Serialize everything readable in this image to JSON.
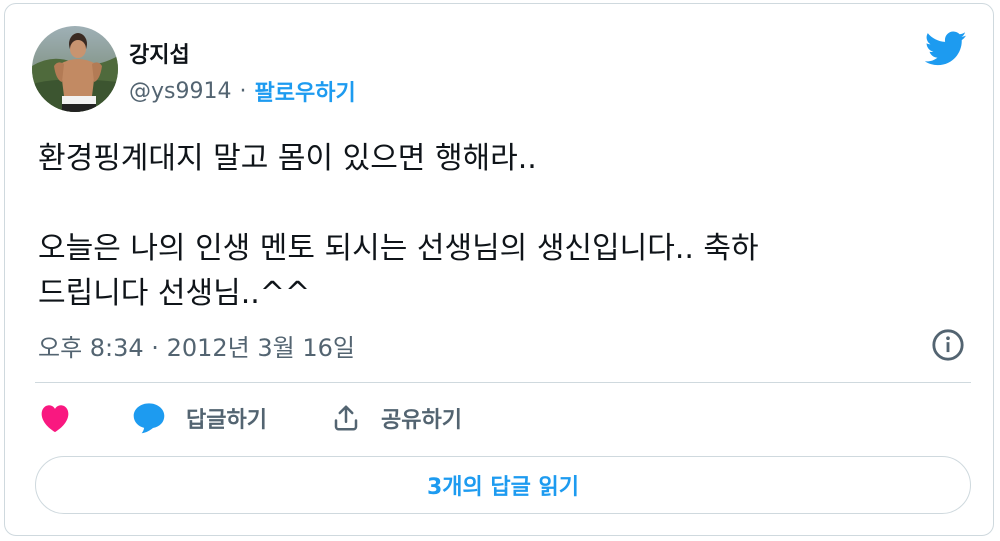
{
  "author": {
    "display_name": "강지섭",
    "handle": "@ys9914",
    "separator": "·",
    "follow_label": "팔로우하기"
  },
  "tweet": {
    "lines": [
      "환경핑계대지 말고 몸이 있으면 행해라..",
      "오늘은 나의 인생 멘토 되시는 선생님의 생신입니다.. 축하",
      "드립니다 선생님..^^"
    ],
    "timestamp": "오후 8:34 · 2012년 3월 16일"
  },
  "actions": {
    "reply_label": "답글하기",
    "share_label": "공유하기"
  },
  "read_replies_label": "3개의 답글 읽기",
  "colors": {
    "accent": "#1d9bf0",
    "like": "#f91880",
    "text": "#0f1419",
    "muted": "#536471",
    "border": "#cfd9de"
  },
  "icons": [
    "twitter-bird-icon",
    "info-icon",
    "heart-icon",
    "reply-bubble-icon",
    "share-icon"
  ]
}
